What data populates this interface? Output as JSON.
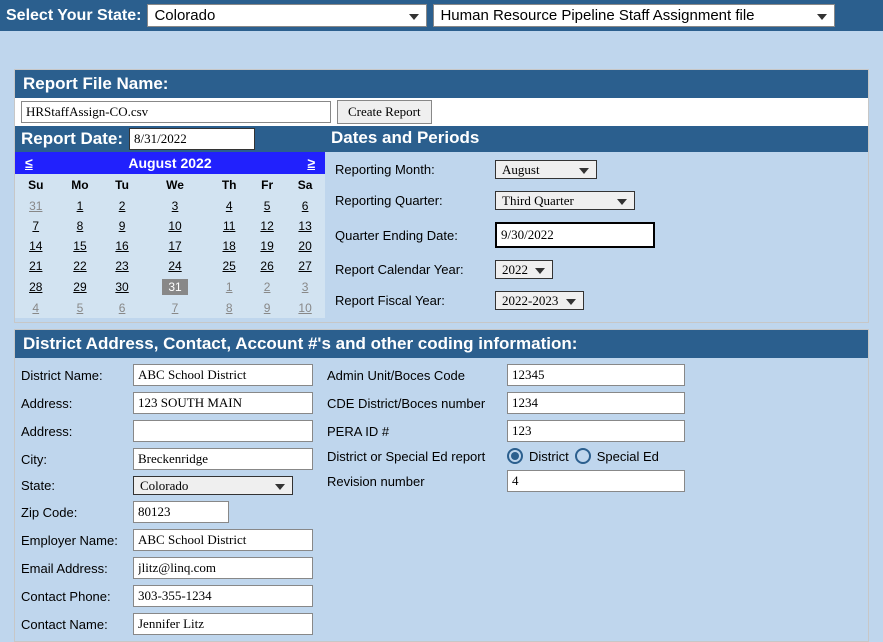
{
  "top": {
    "label": "Select Your State:",
    "state_value": "Colorado",
    "file_value": "Human Resource Pipeline Staff Assignment file"
  },
  "report_file": {
    "header": "Report File Name:",
    "filename": "HRStaffAssign-CO.csv",
    "create_button": "Create Report"
  },
  "report_date": {
    "label": "Report Date:",
    "value": "8/31/2022"
  },
  "calendar": {
    "month_label": "August 2022",
    "prev": "≤",
    "next": "≥",
    "days": [
      "Su",
      "Mo",
      "Tu",
      "We",
      "Th",
      "Fr",
      "Sa"
    ],
    "weeks": [
      [
        {
          "d": "31",
          "o": true
        },
        {
          "d": "1"
        },
        {
          "d": "2"
        },
        {
          "d": "3"
        },
        {
          "d": "4"
        },
        {
          "d": "5"
        },
        {
          "d": "6"
        }
      ],
      [
        {
          "d": "7"
        },
        {
          "d": "8"
        },
        {
          "d": "9"
        },
        {
          "d": "10"
        },
        {
          "d": "11"
        },
        {
          "d": "12"
        },
        {
          "d": "13"
        }
      ],
      [
        {
          "d": "14"
        },
        {
          "d": "15"
        },
        {
          "d": "16"
        },
        {
          "d": "17"
        },
        {
          "d": "18"
        },
        {
          "d": "19"
        },
        {
          "d": "20"
        }
      ],
      [
        {
          "d": "21"
        },
        {
          "d": "22"
        },
        {
          "d": "23"
        },
        {
          "d": "24"
        },
        {
          "d": "25"
        },
        {
          "d": "26"
        },
        {
          "d": "27"
        }
      ],
      [
        {
          "d": "28"
        },
        {
          "d": "29"
        },
        {
          "d": "30"
        },
        {
          "d": "31",
          "sel": true
        },
        {
          "d": "1",
          "o": true
        },
        {
          "d": "2",
          "o": true
        },
        {
          "d": "3",
          "o": true
        }
      ],
      [
        {
          "d": "4",
          "o": true
        },
        {
          "d": "5",
          "o": true
        },
        {
          "d": "6",
          "o": true
        },
        {
          "d": "7",
          "o": true
        },
        {
          "d": "8",
          "o": true
        },
        {
          "d": "9",
          "o": true
        },
        {
          "d": "10",
          "o": true
        }
      ]
    ]
  },
  "dates_periods": {
    "header": "Dates and Periods",
    "reporting_month_label": "Reporting Month:",
    "reporting_month": "August",
    "reporting_quarter_label": "Reporting Quarter:",
    "reporting_quarter": "Third Quarter",
    "quarter_ending_label": "Quarter Ending Date:",
    "quarter_ending": "9/30/2022",
    "calendar_year_label": "Report Calendar Year:",
    "calendar_year": "2022",
    "fiscal_year_label": "Report Fiscal Year:",
    "fiscal_year": "2022-2023"
  },
  "district": {
    "header": "District Address, Contact, Account #'s and other coding information:",
    "name_label": "District Name:",
    "name": "ABC School District",
    "address_label": "Address:",
    "address1": "123 SOUTH MAIN",
    "address2": "",
    "city_label": "City:",
    "city": "Breckenridge",
    "state_label": "State:",
    "state": "Colorado",
    "zip_label": "Zip Code:",
    "zip": "80123",
    "employer_label": "Employer Name:",
    "employer": "ABC School District",
    "email_label": "Email Address:",
    "email": "jlitz@linq.com",
    "phone_label": "Contact Phone:",
    "phone": "303-355-1234",
    "contact_label": "Contact Name:",
    "contact": "Jennifer Litz",
    "admin_unit_label": "Admin Unit/Boces Code",
    "admin_unit": "12345",
    "cde_label": "CDE District/Boces number",
    "cde": "1234",
    "pera_label": "PERA ID #",
    "pera": "123",
    "report_type_label": "District or Special Ed report",
    "radio_district": "District",
    "radio_special": "Special Ed",
    "revision_label": "Revision number",
    "revision": "4"
  }
}
